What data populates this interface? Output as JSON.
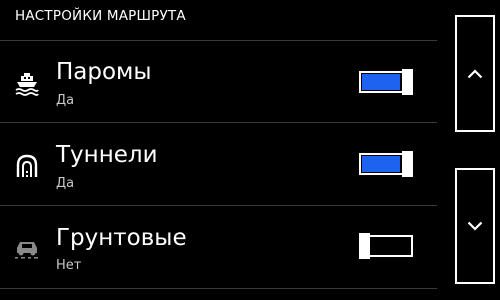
{
  "header": {
    "title": "НАСТРОЙКИ МАРШРУТА"
  },
  "settings": [
    {
      "title": "Паромы",
      "status": "Да",
      "enabled": true,
      "icon": "ferry-icon"
    },
    {
      "title": "Туннели",
      "status": "Да",
      "enabled": true,
      "icon": "tunnel-icon"
    },
    {
      "title": "Грунтовые",
      "status": "Нет",
      "enabled": false,
      "icon": "unpaved-road-icon"
    }
  ],
  "colors": {
    "background": "#000000",
    "text": "#ffffff",
    "accent": "#1e63f0",
    "divider": "#3a3a3a",
    "subtext": "#c8c8c8"
  },
  "scroll": {
    "up_icon": "chevron-up-icon",
    "down_icon": "chevron-down-icon"
  }
}
